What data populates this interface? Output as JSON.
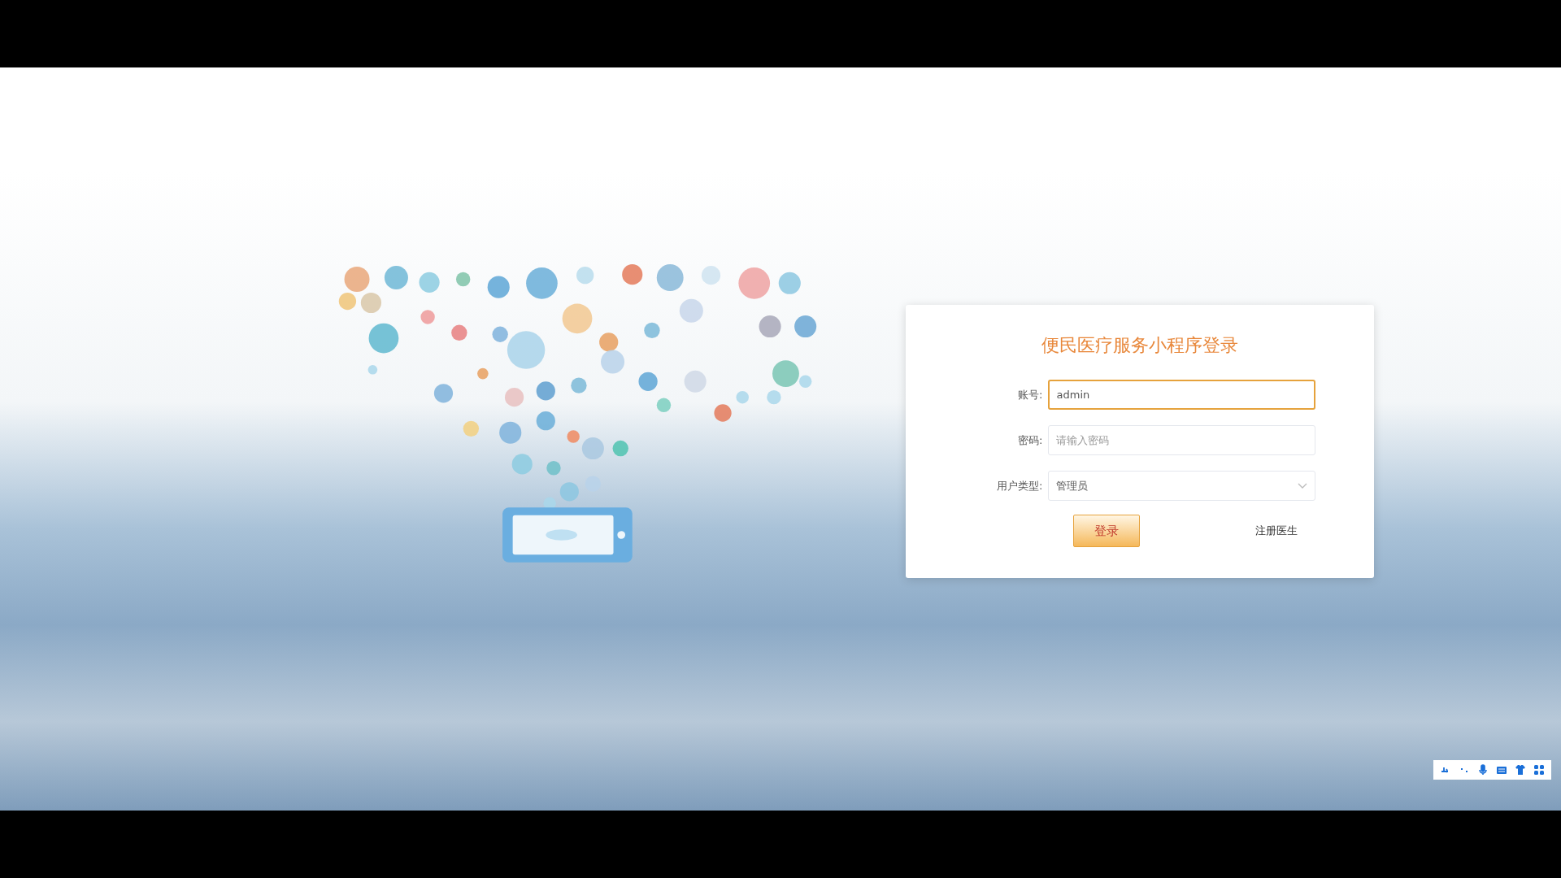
{
  "login": {
    "title": "便民医疗服务小程序登录",
    "fields": [
      {
        "kind": "text",
        "label": "账号:",
        "value": "admin",
        "focused": true
      },
      {
        "kind": "password",
        "label": "密码:",
        "placeholder": "请输入密码",
        "focused": false
      },
      {
        "kind": "select",
        "label": "用户类型:",
        "value": "管理员",
        "focused": false
      }
    ],
    "submit": "登录",
    "register_link": "注册医生"
  }
}
